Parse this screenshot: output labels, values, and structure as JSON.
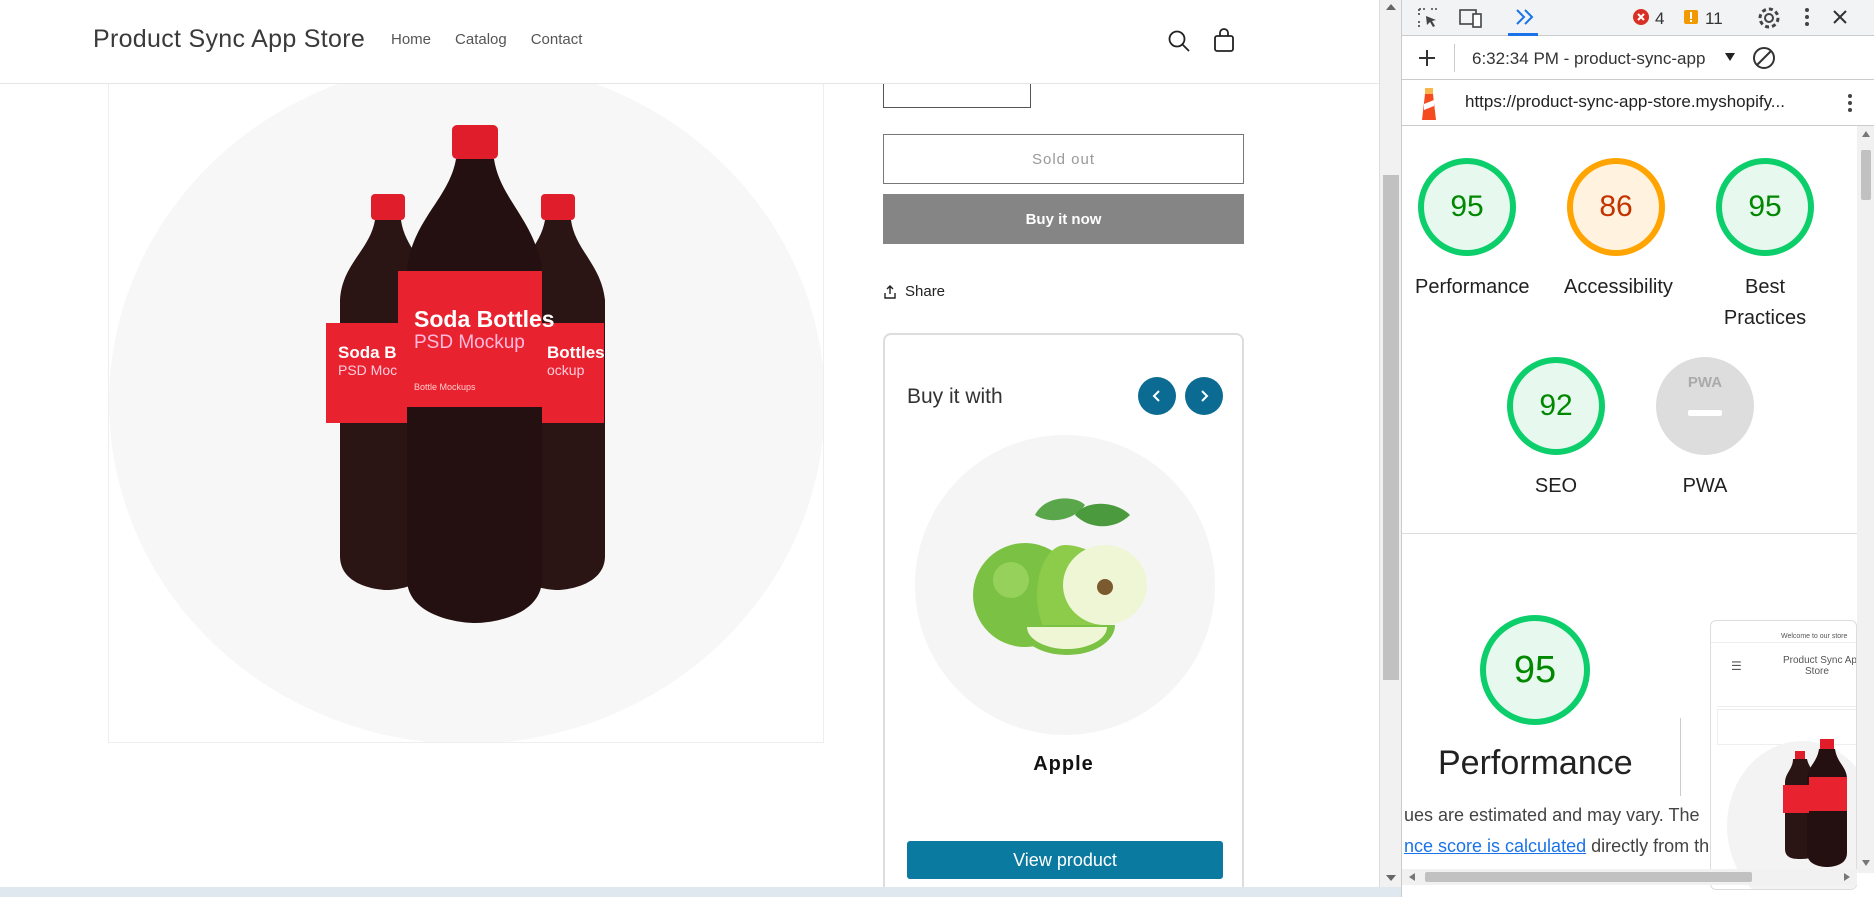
{
  "store": {
    "name": "Product Sync App Store",
    "nav": [
      "Home",
      "Catalog",
      "Contact"
    ]
  },
  "product": {
    "image_label_main": "Soda Bottles",
    "image_label_sub": "PSD Mockup",
    "image_label_side_left": "Soda B",
    "image_label_side_left_sub": "PSD Moc",
    "image_label_side_right": "Bottles",
    "image_label_side_right_sub": "ockup",
    "image_label_small": "Bottle Mockups",
    "sold_out_label": "Sold out",
    "buy_now_label": "Buy it now",
    "share_label": "Share"
  },
  "buy_with": {
    "title": "Buy it with",
    "item_name": "Apple",
    "view_button": "View product"
  },
  "devtools": {
    "errors": "4",
    "warnings": "11",
    "report_label": "6:32:34 PM - product-sync-app",
    "url": "https://product-sync-app-store.myshopify...",
    "scores": [
      {
        "label": "Performance",
        "value": "95",
        "color": "#0cce6b",
        "text_color": "#008800",
        "fill": "#e7f8ee"
      },
      {
        "label": "Accessibility",
        "value": "86",
        "color": "#ffa400",
        "text_color": "#c33300",
        "fill": "#fff3e0"
      },
      {
        "label": "Best",
        "label2": "Practices",
        "value": "95",
        "color": "#0cce6b",
        "text_color": "#008800",
        "fill": "#e7f8ee"
      },
      {
        "label": "SEO",
        "value": "92",
        "color": "#0cce6b",
        "text_color": "#008800",
        "fill": "#e7f8ee"
      },
      {
        "label": "PWA",
        "value": "PWA",
        "color": "#cccccc",
        "text_color": "#888888",
        "fill": "#dddddd"
      }
    ],
    "perf_big_value": "95",
    "perf_title": "Performance",
    "perf_text_1": "ues are estimated and may vary. The",
    "perf_link": "nce score is calculated",
    "perf_text_2": "directly from the",
    "thumb_welcome": "Welcome to our store",
    "thumb_store_line1": "Product Sync Ap",
    "thumb_store_line2": "Store"
  }
}
